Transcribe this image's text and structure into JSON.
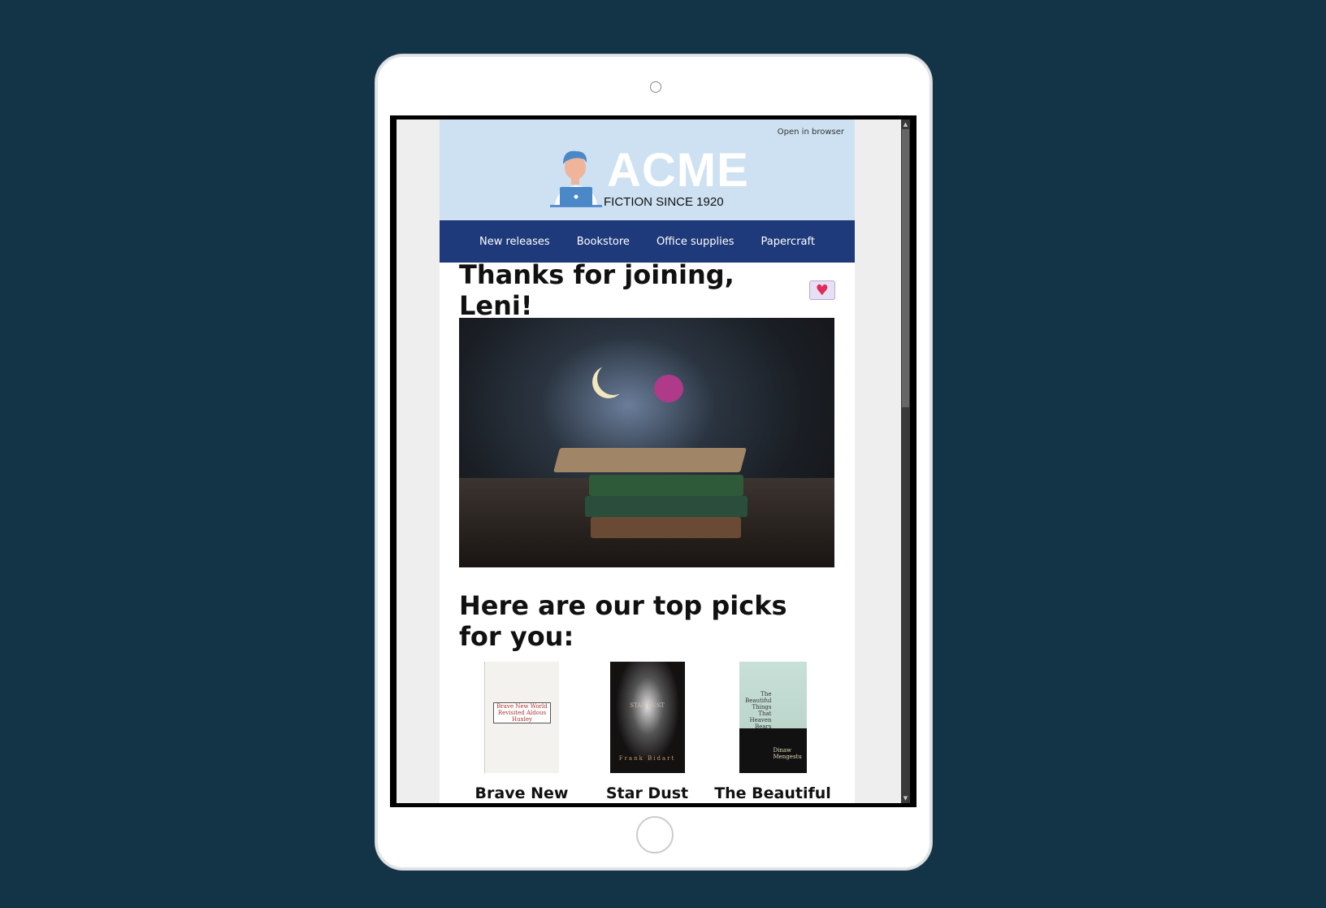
{
  "header": {
    "open_in_browser": "Open in browser",
    "brand": "ACME",
    "tagline": "FICTION SINCE 1920"
  },
  "nav": {
    "items": [
      {
        "label": "New releases"
      },
      {
        "label": "Bookstore"
      },
      {
        "label": "Office supplies"
      },
      {
        "label": "Papercraft"
      }
    ]
  },
  "main": {
    "title": "Thanks for joining, Leni!",
    "title_icon": "love-letter-icon",
    "picks_heading": "Here are our top picks for you:",
    "picks": [
      {
        "title": "Brave New World",
        "cover_text": "Brave New World Revisited Aldous Huxley"
      },
      {
        "title": "Star Dust",
        "cover_text": "STAR DUST",
        "cover_author": "Frank Bidart"
      },
      {
        "title": "The Beautiful Things That Heaven Bears",
        "cover_text": "The Beautiful Things That Heaven Bears",
        "cover_author": "Dinaw Mengestu"
      }
    ]
  },
  "colors": {
    "background": "#133446",
    "header_bg": "#cde1f2",
    "nav_bg": "#1f3a7a"
  }
}
